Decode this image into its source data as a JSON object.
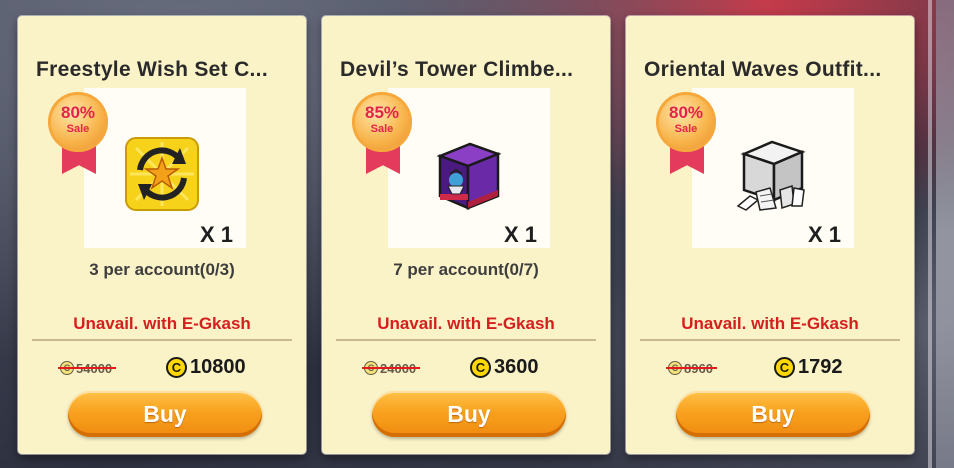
{
  "colors": {
    "card_bg": "#fbf3c8",
    "sale_text": "#e2244a",
    "unavail_text": "#d51f1f",
    "buy_button": "#f8a21e",
    "coin": "#ffd800"
  },
  "products": [
    {
      "title": "Freestyle Wish Set C...",
      "discount": "80%",
      "sale_label": "Sale",
      "icon": "star-reset-coupon-icon",
      "quantity": "X 1",
      "limit": "3 per account(0/3)",
      "unavailable": "Unavail. with E-Gkash",
      "original_price": "54000",
      "coin_symbol": "C",
      "price": "10800",
      "buy_label": "Buy"
    },
    {
      "title": "Devil’s Tower Climbe...",
      "discount": "85%",
      "sale_label": "Sale",
      "icon": "purple-character-box-icon",
      "quantity": "X 1",
      "limit": "7 per account(0/7)",
      "unavailable": "Unavail. with E-Gkash",
      "original_price": "24000",
      "coin_symbol": "C",
      "price": "3600",
      "buy_label": "Buy"
    },
    {
      "title": "Oriental Waves Outfit...",
      "discount": "80%",
      "sale_label": "Sale",
      "icon": "outfit-box-icon",
      "quantity": "X 1",
      "limit": "",
      "unavailable": "Unavail. with E-Gkash",
      "original_price": "8960",
      "coin_symbol": "C",
      "price": "1792",
      "buy_label": "Buy"
    }
  ]
}
